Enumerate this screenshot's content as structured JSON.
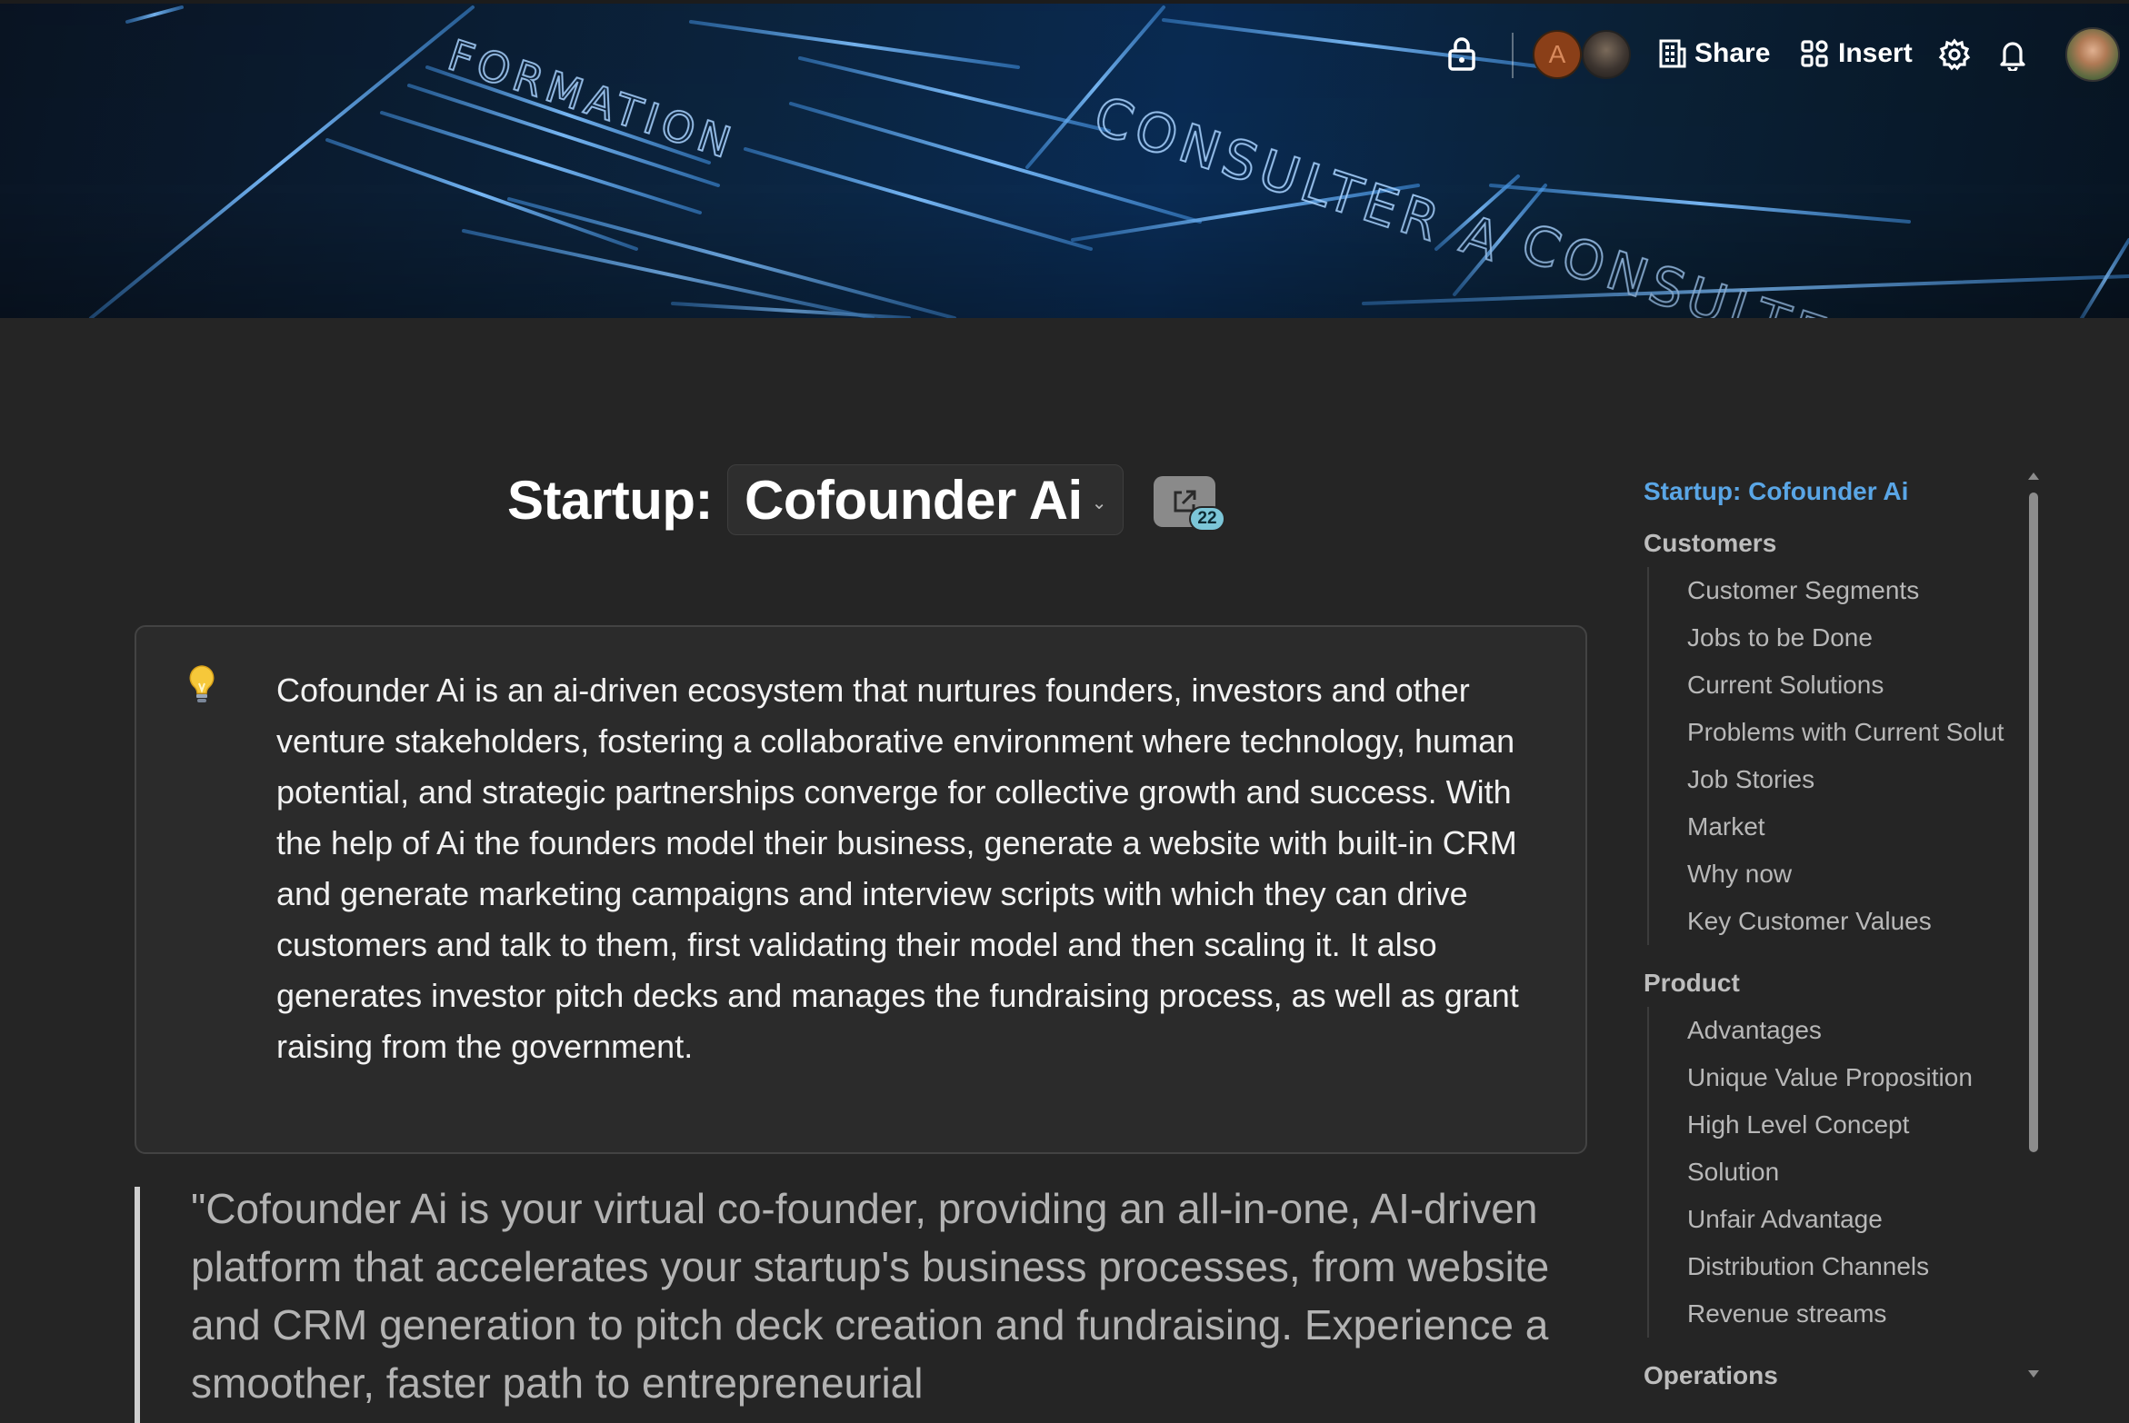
{
  "banner": {
    "sketch_words": [
      "FORMATION",
      "CONSULTER A",
      "CONSULTER"
    ]
  },
  "toolbar": {
    "avatar_initial": "A",
    "share_label": "Share",
    "insert_label": "Insert",
    "icons": [
      "lock-icon",
      "building-icon",
      "grid-icon",
      "gear-icon",
      "bell-icon"
    ]
  },
  "page": {
    "title_prefix": "Startup:",
    "title_name": "Cofounder Ai",
    "link_count": "22"
  },
  "callout": {
    "icon": "lightbulb-icon",
    "text": "Cofounder Ai is an ai-driven ecosystem that nurtures founders, investors and other venture stakeholders, fostering a collaborative environment where technology, human potential, and strategic partnerships converge for collective growth and success. With the help of Ai the founders model their business, generate a website with built-in CRM and generate marketing campaigns and interview scripts with which they can drive customers and talk to them, first validating their model and then scaling it. It also generates investor pitch decks and manages the fundraising process, as well as grant raising from the government."
  },
  "quote": {
    "text": "\"Cofounder Ai is your virtual co-founder, providing an all-in-one, AI-driven platform that accelerates your startup's business processes, from website and CRM generation to pitch deck creation and fundraising. Experience a smoother, faster path to entrepreneurial"
  },
  "toc": {
    "title": "Startup: Cofounder Ai",
    "sections": [
      {
        "label": "Customers",
        "items": [
          "Customer Segments",
          "Jobs to be Done",
          "Current Solutions",
          "Problems with Current Solut",
          "Job Stories",
          "Market",
          "Why now",
          "Key Customer Values"
        ]
      },
      {
        "label": "Product",
        "items": [
          "Advantages",
          "Unique Value Proposition",
          "High Level Concept",
          "Solution",
          "Unfair Advantage",
          "Distribution Channels",
          "Revenue streams"
        ]
      },
      {
        "label": "Operations",
        "items": []
      }
    ]
  },
  "colors": {
    "background": "#252525",
    "toc_active": "#5aa6e6",
    "badge": "#7cc6d8",
    "banner_line": "#6fb4ff"
  }
}
